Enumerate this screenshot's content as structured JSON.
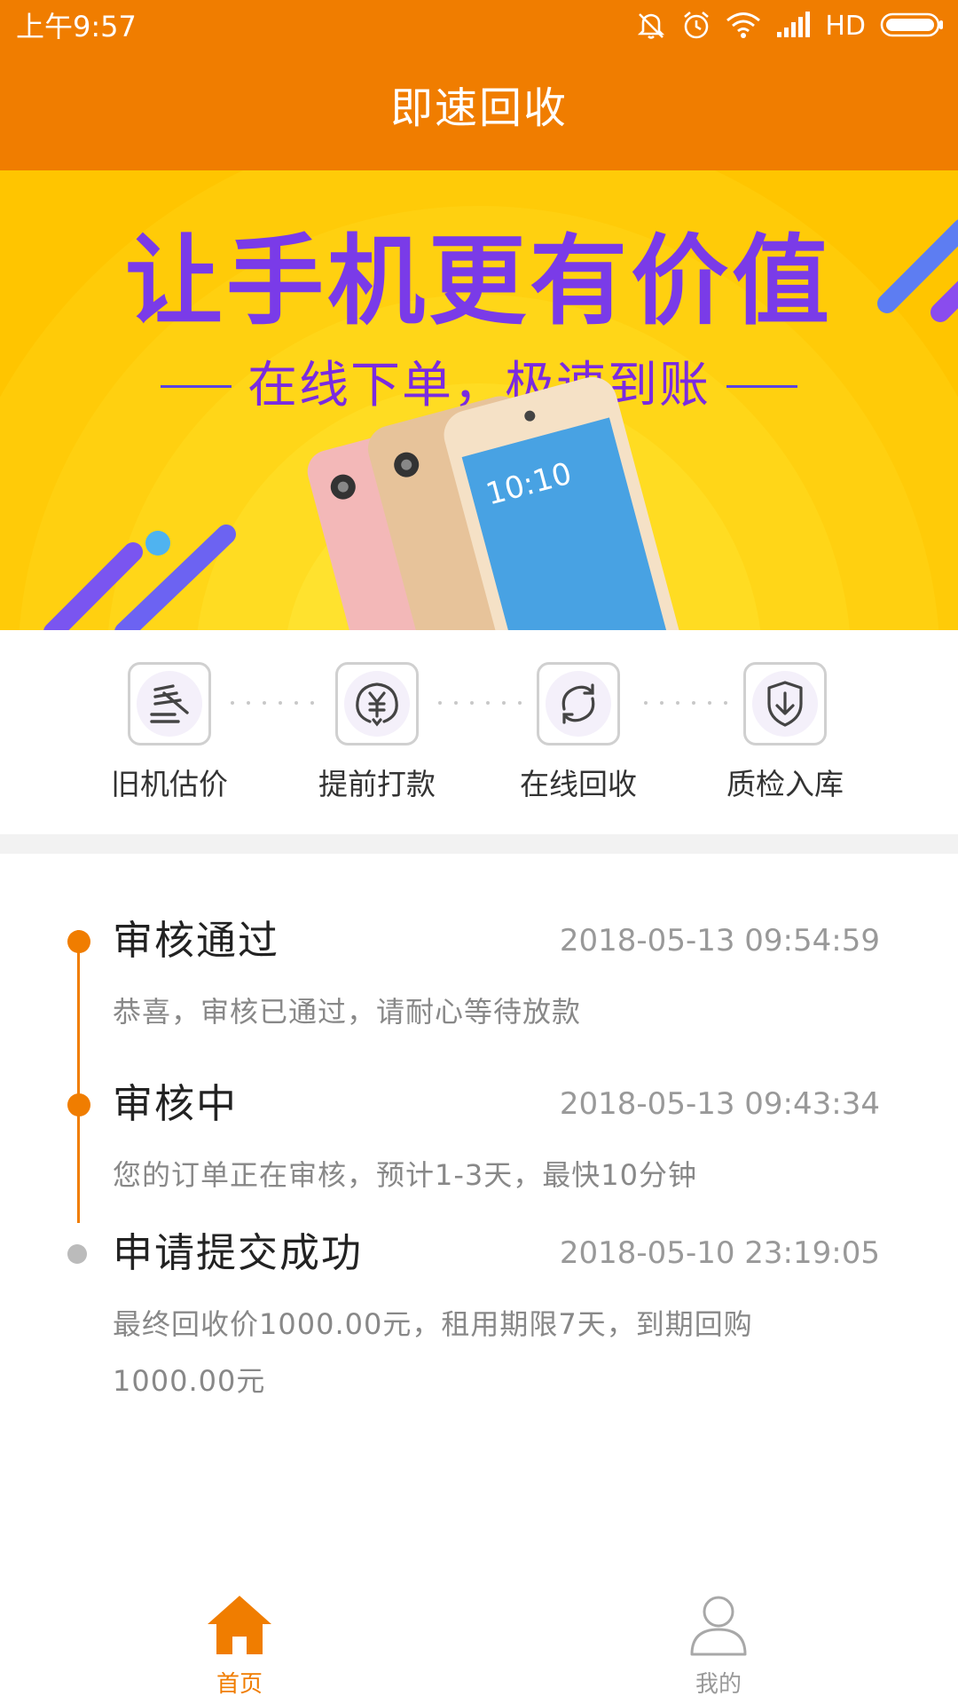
{
  "status_bar": {
    "time": "上午9:57",
    "network": "HD",
    "icons": [
      "mute-icon",
      "alarm-icon",
      "wifi-icon",
      "signal-icon",
      "battery-icon"
    ]
  },
  "header": {
    "title": "即速回收"
  },
  "banner": {
    "headline": "让手机更有价值",
    "subtitle": "在线下单，极速到账",
    "phone_screen_time": "10:10"
  },
  "steps": [
    {
      "label": "旧机估价",
      "icon": "gavel-icon"
    },
    {
      "label": "提前打款",
      "icon": "yuan-coin-icon"
    },
    {
      "label": "在线回收",
      "icon": "recycle-arrows-icon"
    },
    {
      "label": "质检入库",
      "icon": "shield-download-icon"
    }
  ],
  "timeline": [
    {
      "title": "审核通过",
      "time": "2018-05-13 09:54:59",
      "desc": "恭喜，审核已通过，请耐心等待放款",
      "active": true
    },
    {
      "title": "审核中",
      "time": "2018-05-13 09:43:34",
      "desc": "您的订单正在审核，预计1-3天，最快10分钟",
      "active": true
    },
    {
      "title": "申请提交成功",
      "time": "2018-05-10 23:19:05",
      "desc": "最终回收价1000.00元，租用期限7天，到期回购1000.00元",
      "active": false
    }
  ],
  "tab_bar": {
    "items": [
      {
        "label": "首页",
        "icon": "home-icon",
        "selected": true
      },
      {
        "label": "我的",
        "icon": "user-icon",
        "selected": false
      }
    ]
  },
  "colors": {
    "brand": "#F07D00",
    "banner_bg": "#FFC500",
    "headline": "#7A3BE8",
    "muted": "#999999",
    "inactive_dot": "#BBBBBB"
  }
}
